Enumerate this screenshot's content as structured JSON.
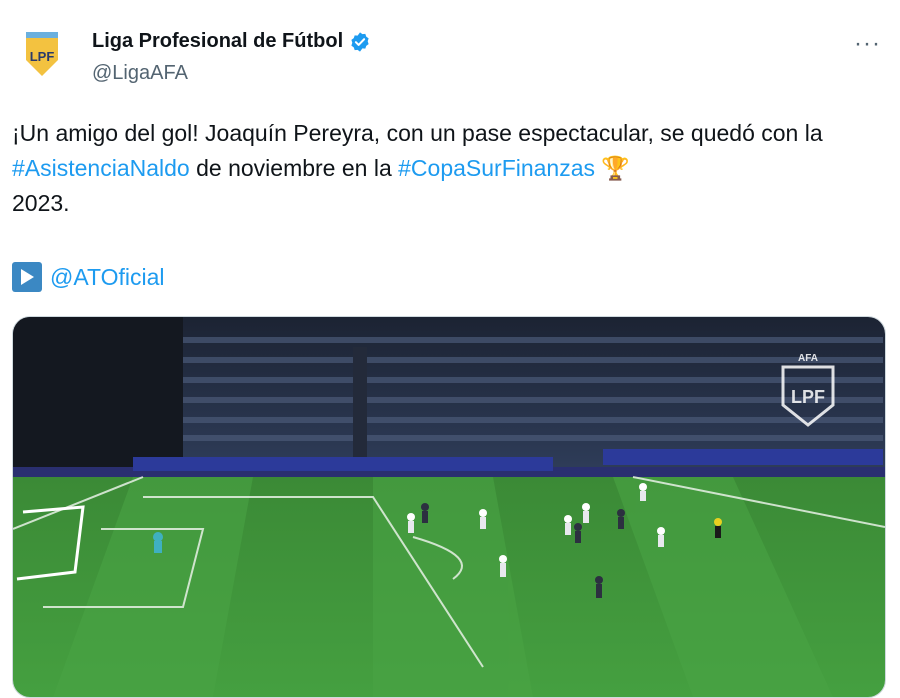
{
  "author": {
    "name": "Liga Profesional de Fútbol",
    "handle": "@LigaAFA",
    "avatar_text": "LPF"
  },
  "tweet": {
    "text_1": "¡Un amigo del gol! Joaquín Pereyra, con un pase espectacular, se quedó con la ",
    "hashtag_1": "#AsistenciaNaldo",
    "text_2": " de noviembre en la ",
    "hashtag_2": "#CopaSurFinanzas",
    "emoji_trophy": "🏆",
    "text_3": " 2023.",
    "mention": "@ATOficial"
  },
  "media": {
    "watermark_top": "AFA",
    "watermark_main": "LPF"
  },
  "colors": {
    "link": "#1d9bf0",
    "verified": "#1d9bf0",
    "pitch": "#3f8f3a"
  },
  "icons": [
    "verified-badge-icon",
    "more-options-icon",
    "play-icon",
    "trophy-icon"
  ]
}
